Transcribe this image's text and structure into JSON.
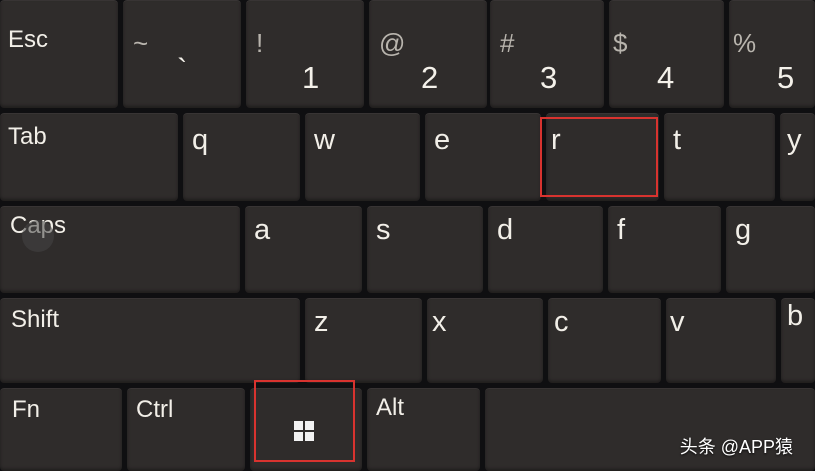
{
  "keyboard": {
    "row1": {
      "esc": "Esc",
      "k1": {
        "shift": "~",
        "base": "`"
      },
      "k2": {
        "shift": "!",
        "base": "1"
      },
      "k3": {
        "shift": "@",
        "base": "2"
      },
      "k4": {
        "shift": "#",
        "base": "3"
      },
      "k5": {
        "shift": "$",
        "base": "4"
      },
      "k6": {
        "shift": "%",
        "base": "5"
      }
    },
    "row2": [
      "Tab",
      "q",
      "w",
      "e",
      "r",
      "t",
      "y"
    ],
    "row3": [
      "Caps",
      "a",
      "s",
      "d",
      "f",
      "g"
    ],
    "row4": [
      "Shift",
      "z",
      "x",
      "c",
      "v",
      "b"
    ],
    "row5": {
      "fn": "Fn",
      "ctrl": "Ctrl",
      "alt": "Alt"
    }
  },
  "highlights": {
    "color": "#d8332f",
    "keys": [
      "r",
      "windows"
    ]
  },
  "icons": [
    "windows-logo-icon"
  ],
  "watermark": "头条 @APP猿"
}
